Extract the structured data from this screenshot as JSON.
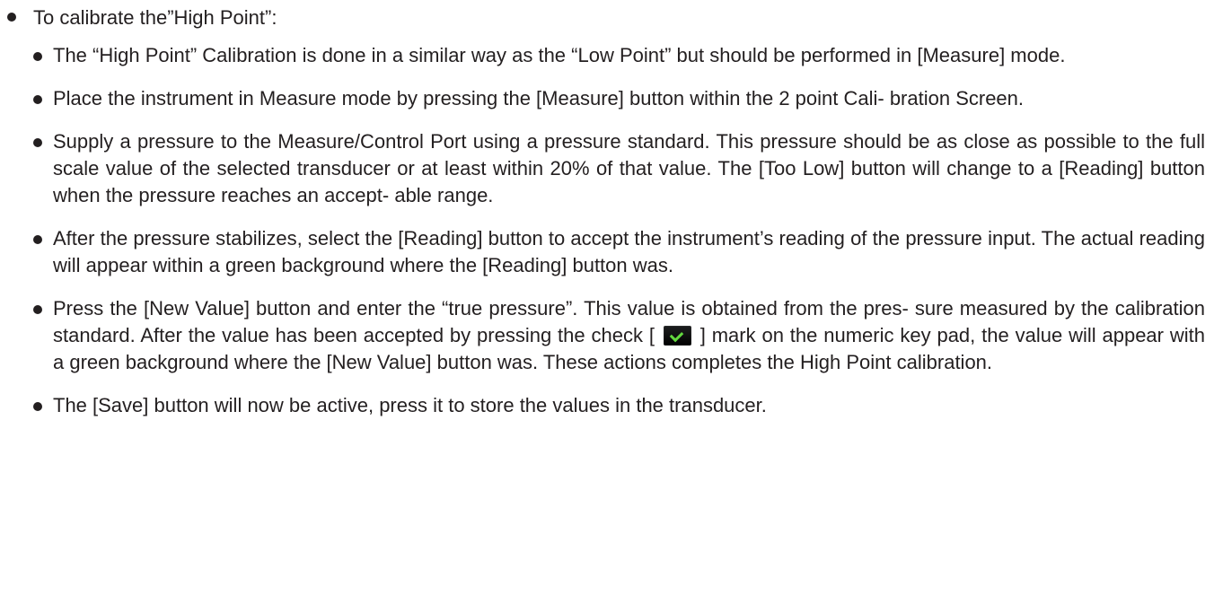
{
  "document": {
    "main_bullet": "To calibrate the”High Point”:",
    "items": [
      "The “High Point” Calibration is done in a similar way as the “Low Point” but should be performed in [Measure] mode.",
      "Place the instrument in Measure mode by pressing the [Measure] button within the 2 point Cali- bration Screen.",
      "Supply a pressure to the Measure/Control Port using a pressure standard. This pressure should be as close as possible to the full scale value of the selected transducer or at least within 20% of that value. The [Too Low] button will change to a [Reading] button when the pressure reaches  an accept- able range.",
      "After the pressure stabilizes, select the [Reading] button to accept the instrument’s reading of the pressure input. The actual reading will appear within a green background where the [Reading] button was.",
      "Press the [New Value] button and enter the “true pressure”. This value is obtained from the pres- sure measured by the calibration standard. After the value has been accepted by pressing the check [",
      "] mark on the numeric key pad, the value will appear with a green background where the [New Value] button was. These actions completes the High Point calibration.",
      "The [Save] button will now be active, press it to store the values in the transducer."
    ],
    "icons": {
      "bullet": "bullet-icon",
      "check": "check-icon"
    },
    "colors": {
      "text": "#231f20",
      "check": "#63d83f"
    }
  }
}
